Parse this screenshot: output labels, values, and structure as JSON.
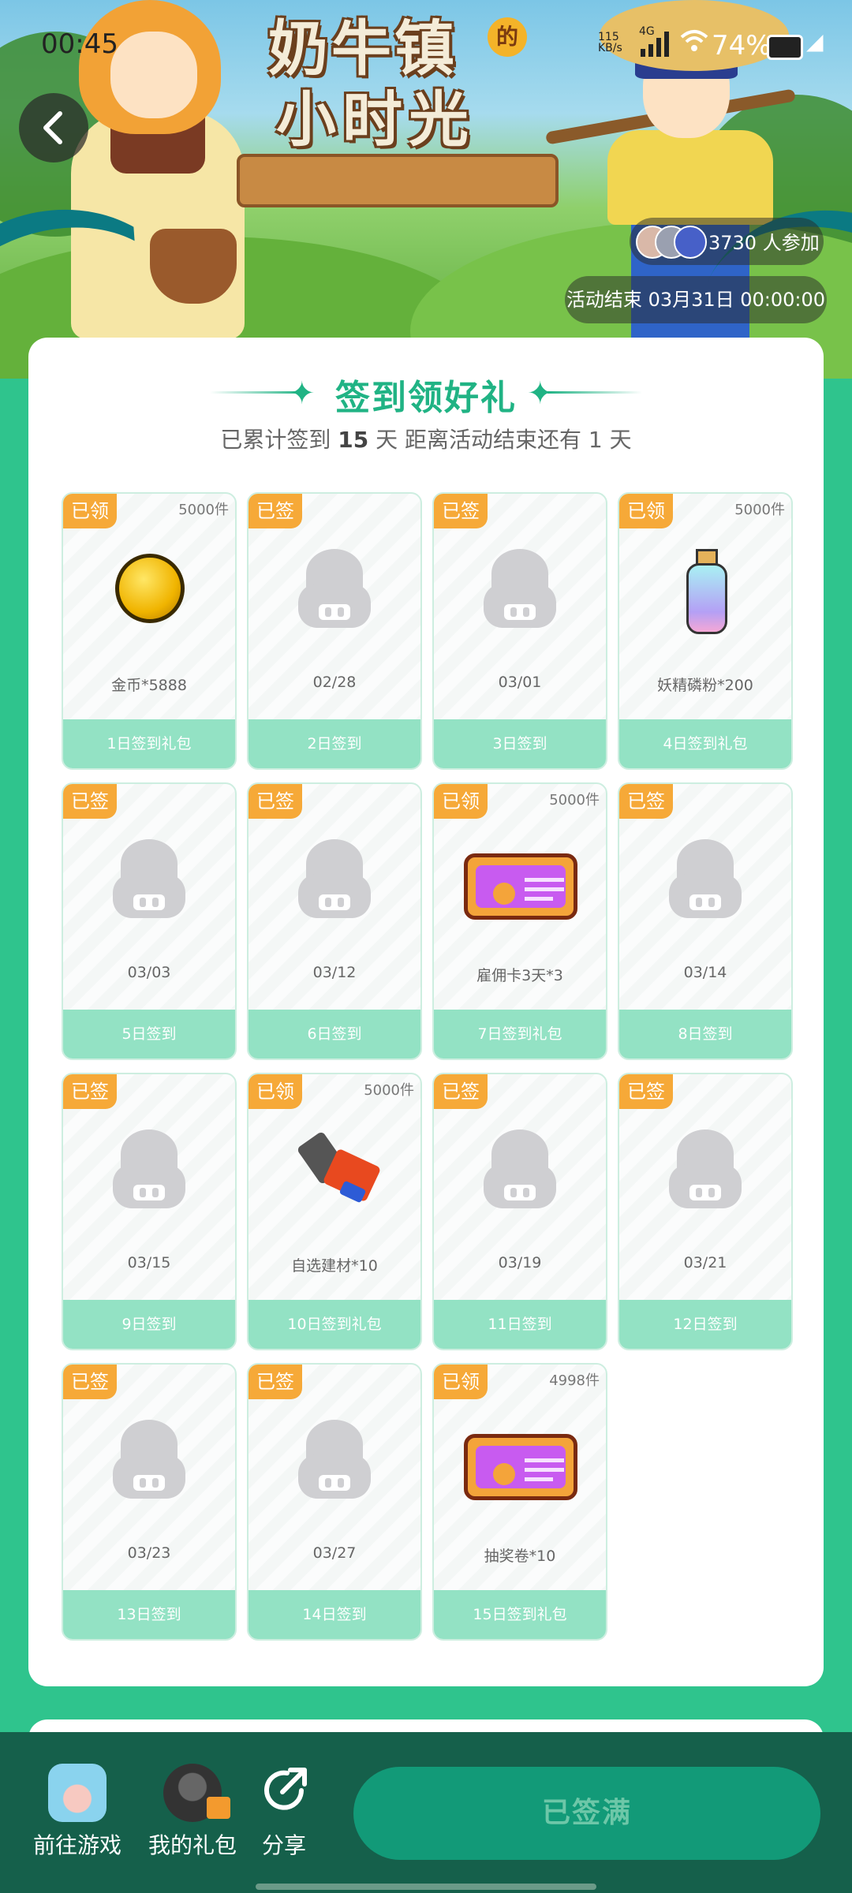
{
  "status_bar": {
    "time": "00:45",
    "network_top": "115",
    "network_bottom": "KB/s",
    "network_type": "4G",
    "battery": "74%"
  },
  "banner": {
    "title_line1": "奶牛镇",
    "title_de": "的",
    "title_line2": "小时光",
    "participants": "3730 人参加",
    "end_time": "活动结束 03月31日 00:00:00"
  },
  "checkin": {
    "title": "签到领好礼",
    "subtitle_prefix": "已累计签到",
    "days": "15",
    "subtitle_mid": "天  距离活动结束还有 1 天"
  },
  "rewards": [
    {
      "tag": "已领",
      "qty": "5000件",
      "name": "金币*5888",
      "footer": "1日签到礼包",
      "icon": "coin-icon"
    },
    {
      "tag": "已签",
      "qty": "",
      "name": "02/28",
      "footer": "2日签到",
      "icon": "placeholder-icon"
    },
    {
      "tag": "已签",
      "qty": "",
      "name": "03/01",
      "footer": "3日签到",
      "icon": "placeholder-icon"
    },
    {
      "tag": "已领",
      "qty": "5000件",
      "name": "妖精磷粉*200",
      "footer": "4日签到礼包",
      "icon": "bottle-icon"
    },
    {
      "tag": "已签",
      "qty": "",
      "name": "03/03",
      "footer": "5日签到",
      "icon": "placeholder-icon"
    },
    {
      "tag": "已签",
      "qty": "",
      "name": "03/12",
      "footer": "6日签到",
      "icon": "placeholder-icon"
    },
    {
      "tag": "已领",
      "qty": "5000件",
      "name": "雇佣卡3天*3",
      "footer": "7日签到礼包",
      "icon": "ticket-icon"
    },
    {
      "tag": "已签",
      "qty": "",
      "name": "03/14",
      "footer": "8日签到",
      "icon": "placeholder-icon"
    },
    {
      "tag": "已签",
      "qty": "",
      "name": "03/15",
      "footer": "9日签到",
      "icon": "placeholder-icon"
    },
    {
      "tag": "已领",
      "qty": "5000件",
      "name": "自选建材*10",
      "footer": "10日签到礼包",
      "icon": "building-kit-icon"
    },
    {
      "tag": "已签",
      "qty": "",
      "name": "03/19",
      "footer": "11日签到",
      "icon": "placeholder-icon"
    },
    {
      "tag": "已签",
      "qty": "",
      "name": "03/21",
      "footer": "12日签到",
      "icon": "placeholder-icon"
    },
    {
      "tag": "已签",
      "qty": "",
      "name": "03/23",
      "footer": "13日签到",
      "icon": "placeholder-icon"
    },
    {
      "tag": "已签",
      "qty": "",
      "name": "03/27",
      "footer": "14日签到",
      "icon": "placeholder-icon"
    },
    {
      "tag": "已领",
      "qty": "4998件",
      "name": "抽奖卷*10",
      "footer": "15日签到礼包",
      "icon": "ticket-icon"
    }
  ],
  "bottom_bar": {
    "go_game": "前往游戏",
    "my_gifts": "我的礼包",
    "share": "分享",
    "signed_full": "已签满"
  },
  "colors": {
    "accent": "#20b384",
    "tag": "#f6a938",
    "footer": "#93e2c4",
    "page_bg": "#2fc48d",
    "bottom_bar": "#15604b"
  }
}
